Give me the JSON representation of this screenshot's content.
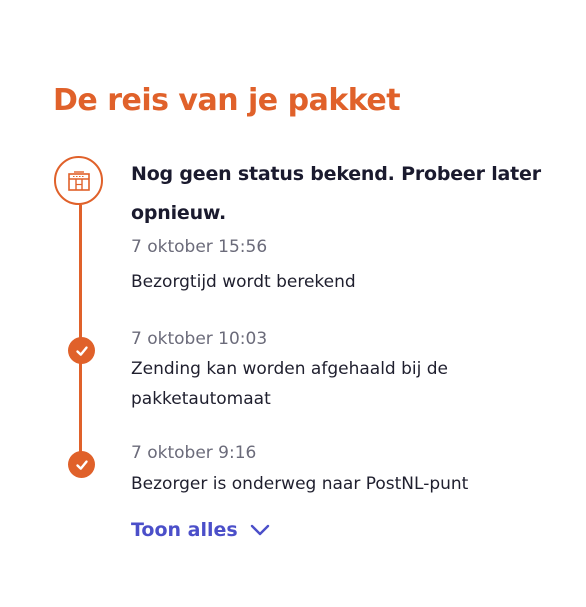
{
  "colors": {
    "accent": "#e0612a",
    "heading_text": "#1a1a2e",
    "body_text": "#1f1f2e",
    "muted_text": "#6b6b7a",
    "link": "#4b4fc9",
    "icon_fill": "#ffffff"
  },
  "page": {
    "title": "De reis van je pakket"
  },
  "timeline": {
    "current": {
      "icon": "parcel-locker-icon",
      "status": "Nog geen status bekend. Probeer later opnieuw.",
      "timestamp": "7 oktober 15:56",
      "description": "Bezorgtijd wordt berekend"
    },
    "events": [
      {
        "icon": "checkmark-icon",
        "timestamp": "7 oktober 10:03",
        "description": "Zending kan worden afgehaald bij de pakketautomaat"
      },
      {
        "icon": "checkmark-icon",
        "timestamp": "7 oktober 9:16",
        "description": "Bezorger is onderweg naar PostNL-punt"
      }
    ]
  },
  "toggle": {
    "label": "Toon alles",
    "icon": "chevron-down-icon"
  }
}
